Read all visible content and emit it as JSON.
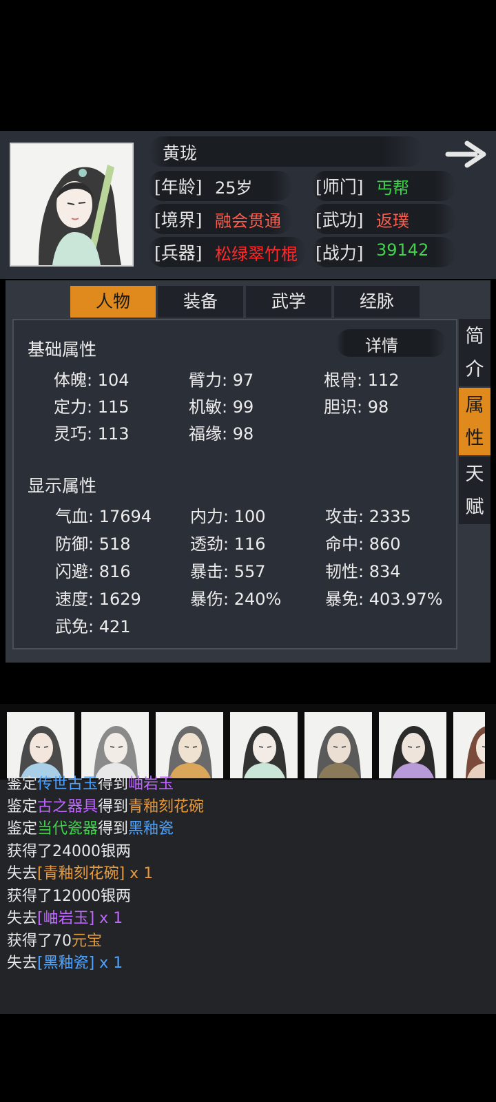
{
  "character": {
    "name": "黄珑",
    "fields": [
      {
        "label": "[年龄]",
        "value": "25岁",
        "color": "#e6e6e6"
      },
      {
        "label": "[师门]",
        "value": "丐帮",
        "color": "#3fd34a"
      },
      {
        "label": "[境界]",
        "value": "融会贯通",
        "color": "#ff5a4a"
      },
      {
        "label": "[武功]",
        "value": "返璞",
        "color": "#ff5a4a"
      },
      {
        "label": "[兵器]",
        "value": "松绿翠竹棍",
        "color": "#ff2a2a"
      },
      {
        "label": "[战力]",
        "value": "39142",
        "color": "#3fd34a"
      }
    ]
  },
  "tabs": [
    "人物",
    "装备",
    "武学",
    "经脉"
  ],
  "side_tabs": [
    "简介",
    "属性",
    "天赋"
  ],
  "detail_label": "详情",
  "basic": {
    "title": "基础属性",
    "stats": [
      "体魄: 104",
      "臂力: 97",
      "根骨: 112",
      "定力: 115",
      "机敏: 99",
      "胆识: 98",
      "灵巧: 113",
      "福缘: 98"
    ]
  },
  "display": {
    "title": "显示属性",
    "stats": [
      "气血: 17694",
      "内力: 100",
      "攻击: 2335",
      "防御: 518",
      "透劲: 116",
      "命中: 860",
      "闪避: 816",
      "暴击: 557",
      "韧性: 834",
      "速度: 1629",
      "暴伤: 240%",
      "暴免: 403.97%",
      "武免: 421"
    ]
  },
  "log": [
    {
      "segs": [
        {
          "t": "鉴定",
          "c": "#e8e8e8"
        },
        {
          "t": "传世古玉",
          "c": "#4da3ff"
        },
        {
          "t": "得到",
          "c": "#e8e8e8"
        },
        {
          "t": "岫岩玉",
          "c": "#c067ff"
        }
      ]
    },
    {
      "segs": [
        {
          "t": "鉴定",
          "c": "#e8e8e8"
        },
        {
          "t": "古之器具",
          "c": "#c067ff"
        },
        {
          "t": "得到",
          "c": "#e8e8e8"
        },
        {
          "t": "青釉刻花碗",
          "c": "#e89a3a"
        }
      ]
    },
    {
      "segs": [
        {
          "t": "鉴定",
          "c": "#e8e8e8"
        },
        {
          "t": "当代瓷器",
          "c": "#3fd34a"
        },
        {
          "t": "得到",
          "c": "#e8e8e8"
        },
        {
          "t": "黑釉瓷",
          "c": "#4da3ff"
        }
      ]
    },
    {
      "segs": [
        {
          "t": "获得了24000银两",
          "c": "#e8e8e8"
        }
      ]
    },
    {
      "segs": [
        {
          "t": "失去",
          "c": "#e8e8e8"
        },
        {
          "t": "[青釉刻花碗] x 1",
          "c": "#e89a3a"
        }
      ]
    },
    {
      "segs": [
        {
          "t": "获得了12000银两",
          "c": "#e8e8e8"
        }
      ]
    },
    {
      "segs": [
        {
          "t": "失去",
          "c": "#e8e8e8"
        },
        {
          "t": "[岫岩玉] x 1",
          "c": "#c067ff"
        }
      ]
    },
    {
      "segs": [
        {
          "t": "获得了70",
          "c": "#e8e8e8"
        },
        {
          "t": "元宝",
          "c": "#e89a3a"
        }
      ]
    },
    {
      "segs": [
        {
          "t": "失去",
          "c": "#e8e8e8"
        },
        {
          "t": "[黑釉瓷] x 1",
          "c": "#4da3ff"
        }
      ]
    }
  ],
  "roster_count": 7
}
